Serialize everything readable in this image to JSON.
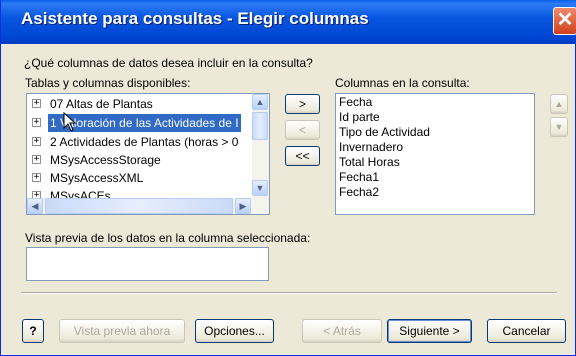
{
  "window": {
    "title": "Asistente para consultas - Elegir columnas",
    "close_glyph": "✕"
  },
  "prompt": "¿Qué columnas de datos desea incluir en la consulta?",
  "available": {
    "label": "Tablas y columnas disponibles:",
    "items": [
      {
        "label": "07 Altas de Plantas",
        "selected": false
      },
      {
        "label": "1 Valoración de las Actividades de I",
        "selected": true
      },
      {
        "label": "2 Actividades de Plantas (horas > 0",
        "selected": false
      },
      {
        "label": "MSysAccessStorage",
        "selected": false
      },
      {
        "label": "MSysAccessXML",
        "selected": false
      },
      {
        "label": "MSysACEs",
        "selected": false
      }
    ],
    "expander_glyph": "+"
  },
  "move_buttons": {
    "add": ">",
    "remove": "<",
    "remove_all": "<<"
  },
  "query_columns": {
    "label": "Columnas en la consulta:",
    "items": [
      "Fecha",
      "Id parte",
      "Tipo de Actividad",
      "Invernadero",
      "Total Horas",
      "Fecha1",
      "Fecha2"
    ]
  },
  "preview": {
    "label": "Vista previa de los datos en la columna seleccionada:",
    "value": ""
  },
  "footer": {
    "help_glyph": "?",
    "preview_now": "Vista previa ahora",
    "options": "Opciones...",
    "back": "< Atrás",
    "next": "Siguiente >",
    "cancel": "Cancelar"
  },
  "colors": {
    "title_bar": "#0054e3",
    "selection": "#316ac5",
    "dialog_bg": "#ece9d8",
    "close_button": "#d1401d"
  }
}
